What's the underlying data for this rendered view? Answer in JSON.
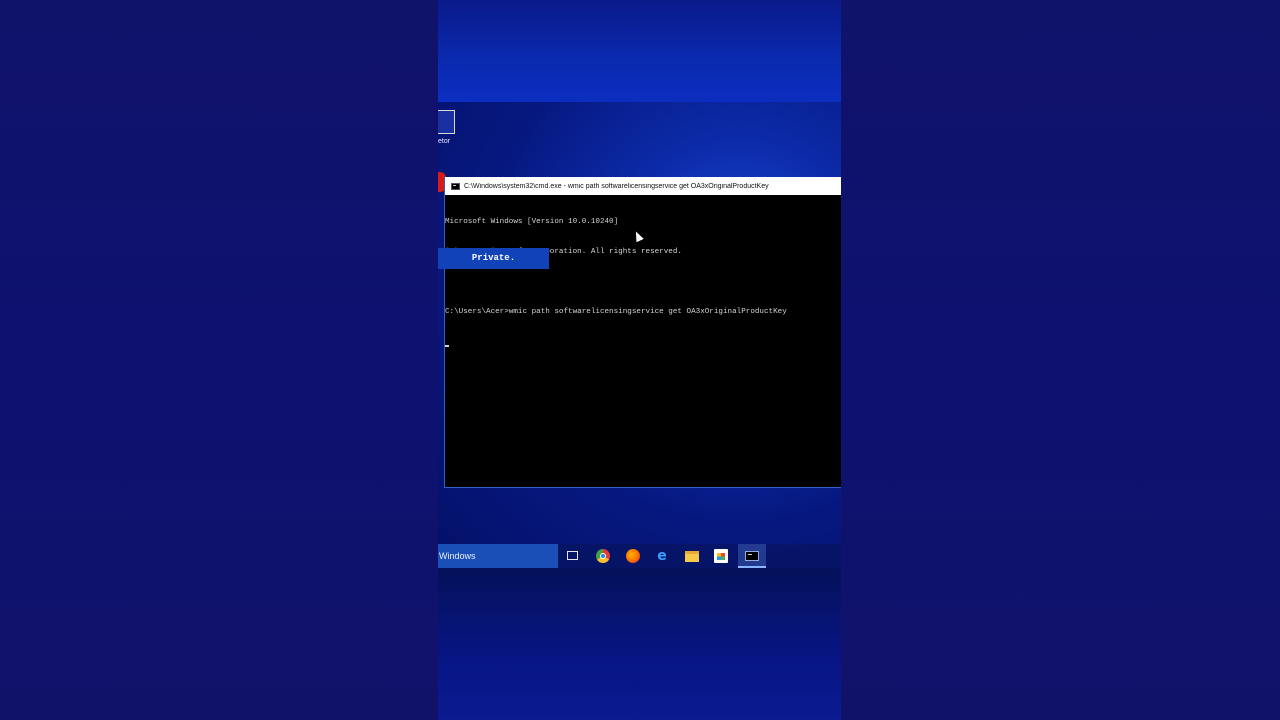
{
  "window": {
    "title": "C:\\Windows\\system32\\cmd.exe - wmic path softwarelicensingservice get OA3xOriginalProductKey"
  },
  "terminal": {
    "lines": [
      "Microsoft Windows [Version 10.0.10240]",
      "(c) 2015 Microsoft Corporation. All rights reserved.",
      "",
      "C:\\Users\\Acer>wmic path softwarelicensingservice get OA3xOriginalProductKey"
    ]
  },
  "overlay": {
    "private_label": "Private."
  },
  "desktop": {
    "icon_label": "etor"
  },
  "taskbar": {
    "search_text": "Windows",
    "icons": [
      "task-view-icon",
      "chrome-icon",
      "firefox-icon",
      "edge-icon",
      "file-explorer-icon",
      "store-icon",
      "cmd-icon"
    ],
    "edge_glyph": "e"
  },
  "colors": {
    "terminal_bg": "#000000",
    "terminal_fg": "#d4d4d4",
    "accent": "#1242b8",
    "desktop_blue": "#0c2aa8"
  }
}
